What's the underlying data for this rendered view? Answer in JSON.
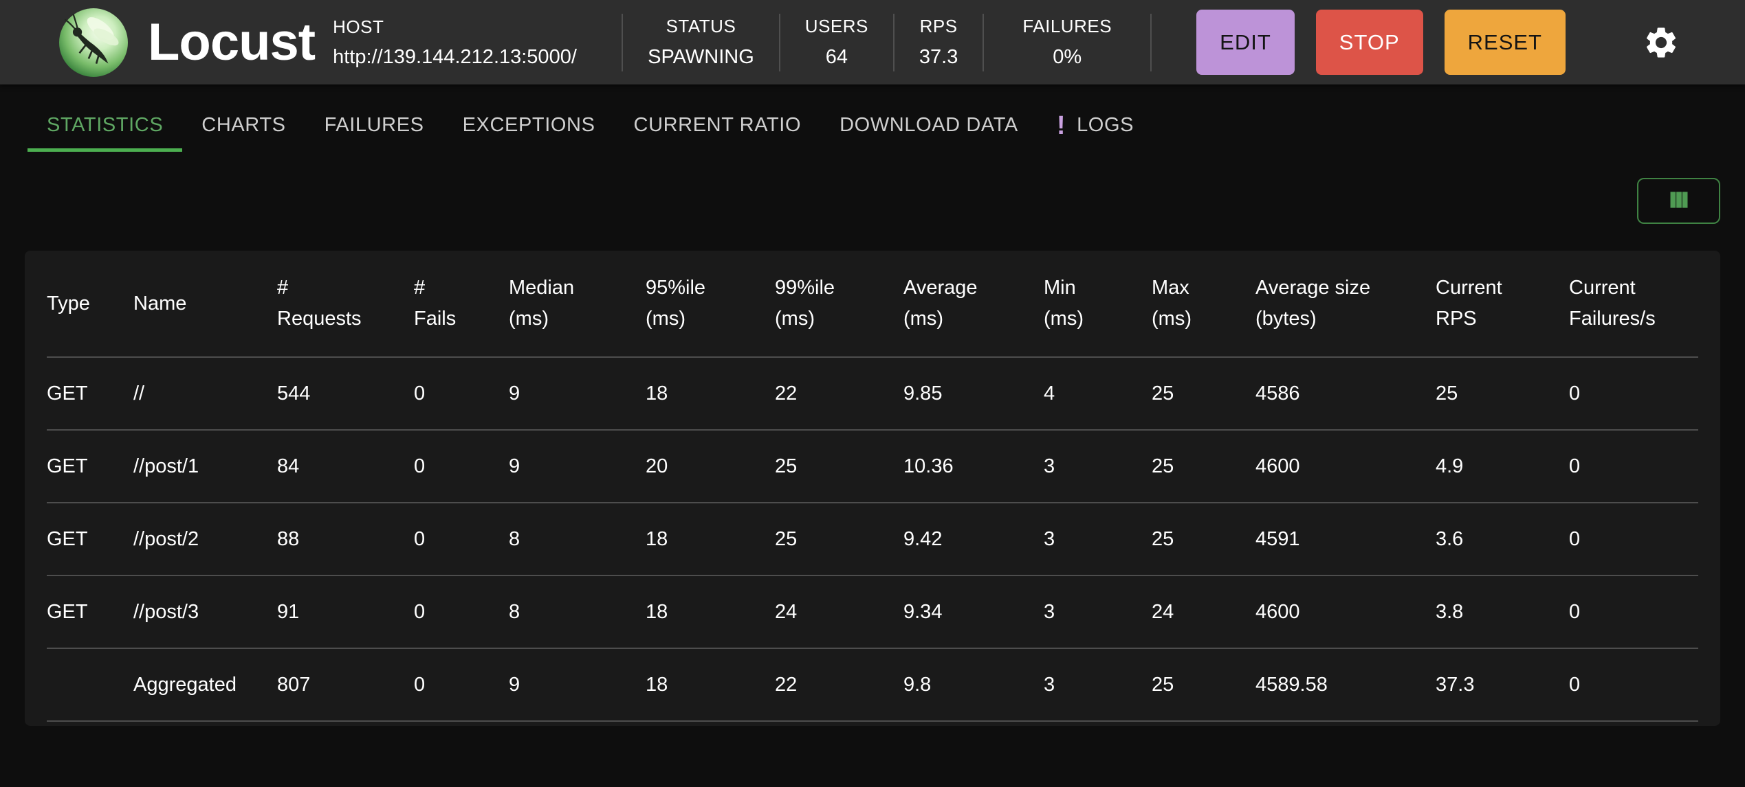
{
  "app": {
    "title": "Locust"
  },
  "header": {
    "host": {
      "label": "HOST",
      "value": "http://139.144.212.13:5000/"
    },
    "status": {
      "label": "STATUS",
      "value": "SPAWNING"
    },
    "users": {
      "label": "USERS",
      "value": "64"
    },
    "rps": {
      "label": "RPS",
      "value": "37.3"
    },
    "failures": {
      "label": "FAILURES",
      "value": "0%"
    },
    "buttons": {
      "edit": "EDIT",
      "stop": "STOP",
      "reset": "RESET"
    }
  },
  "tabs": [
    {
      "label": "STATISTICS",
      "active": true
    },
    {
      "label": "CHARTS",
      "active": false
    },
    {
      "label": "FAILURES",
      "active": false
    },
    {
      "label": "EXCEPTIONS",
      "active": false
    },
    {
      "label": "CURRENT RATIO",
      "active": false
    },
    {
      "label": "DOWNLOAD DATA",
      "active": false
    },
    {
      "label": "LOGS",
      "active": false,
      "badge": "!"
    }
  ],
  "colors": {
    "accent_green": "#4caf50",
    "tab_active_green": "#5fa763",
    "edit_button": "#bd93d8",
    "stop_button": "#dd5448",
    "reset_button": "#eea63d",
    "logs_badge": "#c9a1e0",
    "appbar_bg": "#2e2e2e",
    "card_bg": "#1a1a1a"
  },
  "table": {
    "columns": [
      "Type",
      "Name",
      "#\nRequests",
      "#\nFails",
      "Median\n(ms)",
      "95%ile\n(ms)",
      "99%ile\n(ms)",
      "Average\n(ms)",
      "Min\n(ms)",
      "Max\n(ms)",
      "Average size\n(bytes)",
      "Current\nRPS",
      "Current\nFailures/s"
    ],
    "rows": [
      [
        "GET",
        "//",
        "544",
        "0",
        "9",
        "18",
        "22",
        "9.85",
        "4",
        "25",
        "4586",
        "25",
        "0"
      ],
      [
        "GET",
        "//post/1",
        "84",
        "0",
        "9",
        "20",
        "25",
        "10.36",
        "3",
        "25",
        "4600",
        "4.9",
        "0"
      ],
      [
        "GET",
        "//post/2",
        "88",
        "0",
        "8",
        "18",
        "25",
        "9.42",
        "3",
        "25",
        "4591",
        "3.6",
        "0"
      ],
      [
        "GET",
        "//post/3",
        "91",
        "0",
        "8",
        "18",
        "24",
        "9.34",
        "3",
        "24",
        "4600",
        "3.8",
        "0"
      ],
      [
        "",
        "Aggregated",
        "807",
        "0",
        "9",
        "18",
        "22",
        "9.8",
        "3",
        "25",
        "4589.58",
        "37.3",
        "0"
      ]
    ]
  }
}
